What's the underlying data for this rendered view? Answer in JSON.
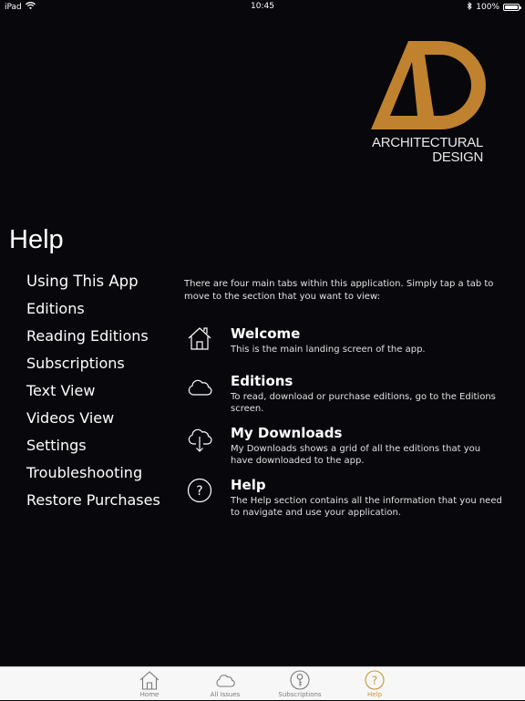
{
  "status_bar": {
    "device": "iPad",
    "time": "10:45",
    "battery_text": "100%",
    "battery_level": 1.0
  },
  "logo": {
    "line1": "ARCHITECTURAL",
    "line2": "DESIGN",
    "color": "#c0822f"
  },
  "page": {
    "title": "Help"
  },
  "side_menu": {
    "items": [
      {
        "label": "Using This App"
      },
      {
        "label": "Editions"
      },
      {
        "label": "Reading Editions"
      },
      {
        "label": "Subscriptions"
      },
      {
        "label": "Text View"
      },
      {
        "label": "Videos View"
      },
      {
        "label": "Settings"
      },
      {
        "label": "Troubleshooting"
      },
      {
        "label": "Restore Purchases"
      }
    ]
  },
  "content": {
    "intro": "There are four main tabs within this application. Simply tap a tab to move to the section that you want to view:",
    "features": [
      {
        "icon": "home-icon",
        "title": "Welcome",
        "description": "This is the main landing screen of the app."
      },
      {
        "icon": "cloud-icon",
        "title": "Editions",
        "description": "To read, download or purchase editions, go to the Editions screen."
      },
      {
        "icon": "cloud-download-icon",
        "title": "My Downloads",
        "description": "My Downloads shows a grid of all the editions that you have downloaded to the app."
      },
      {
        "icon": "question-icon",
        "title": "Help",
        "description": "The Help section contains all the information that you need to navigate and use your application."
      }
    ]
  },
  "tab_bar": {
    "active_color": "#c9963a",
    "tabs": [
      {
        "label": "Home",
        "icon": "home-icon"
      },
      {
        "label": "All Issues",
        "icon": "cloud-icon"
      },
      {
        "label": "Subscriptions",
        "icon": "key-icon"
      },
      {
        "label": "Help",
        "icon": "question-icon",
        "active": true
      }
    ]
  }
}
